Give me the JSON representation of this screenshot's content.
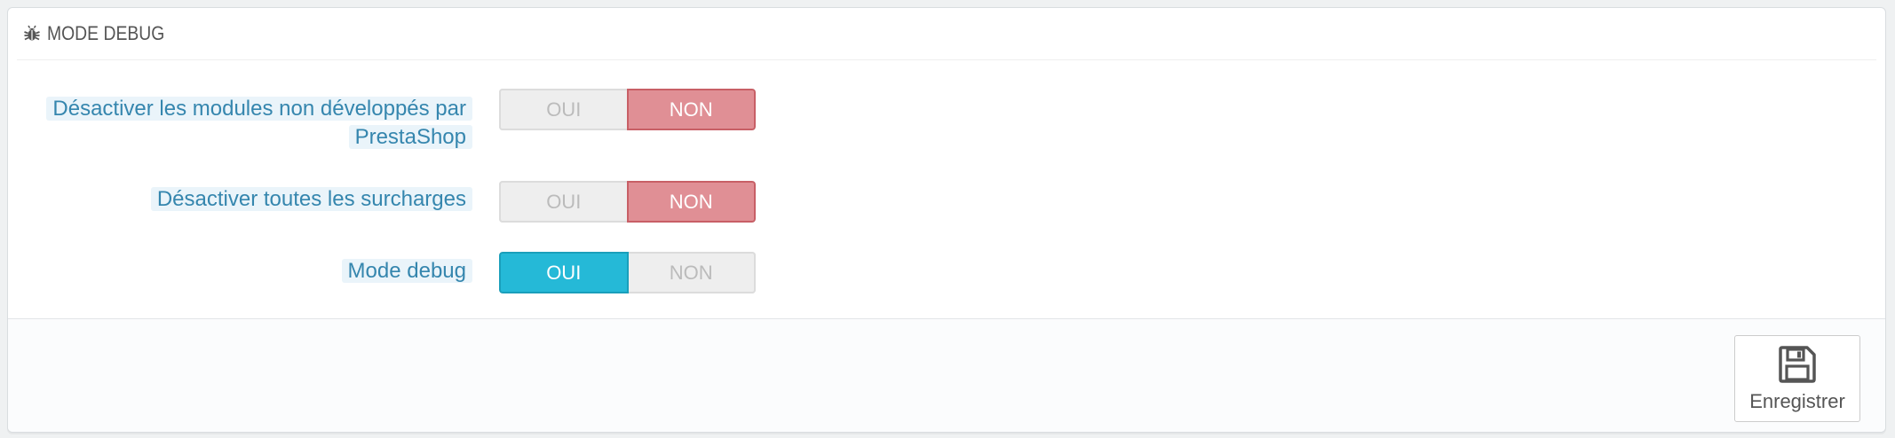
{
  "panel": {
    "title": "MODE DEBUG",
    "title_icon": "bug-icon"
  },
  "options": [
    {
      "label": "Désactiver les modules non développés par PrestaShop",
      "on_label": "OUI",
      "off_label": "NON",
      "value": "NON"
    },
    {
      "label": "Désactiver toutes les surcharges",
      "on_label": "OUI",
      "off_label": "NON",
      "value": "NON"
    },
    {
      "label": "Mode debug",
      "on_label": "OUI",
      "off_label": "NON",
      "value": "OUI"
    }
  ],
  "footer": {
    "save_label": "Enregistrer",
    "save_icon": "save-icon"
  },
  "colors": {
    "switch_on": "#25b9d7",
    "switch_off": "#e08f95",
    "label": "#3586ae",
    "label_bg": "#eaf4fa"
  }
}
